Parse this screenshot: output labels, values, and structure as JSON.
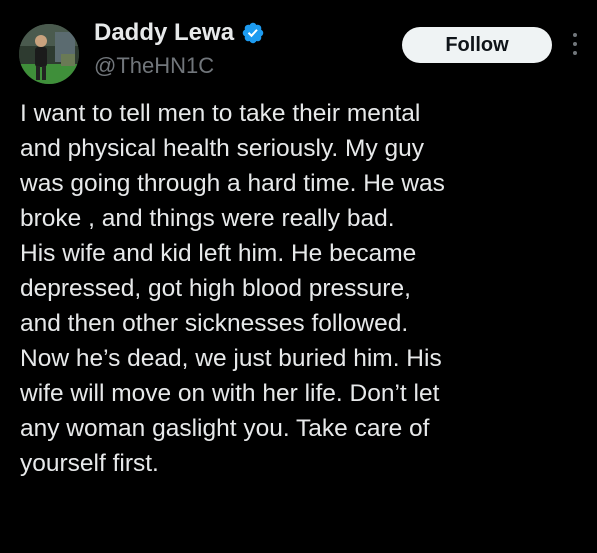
{
  "author": {
    "display_name": "Daddy Lewa",
    "handle": "@TheHN1C",
    "verified": true
  },
  "actions": {
    "follow_label": "Follow"
  },
  "tweet": {
    "lines": [
      "I want to tell men to take their mental",
      "and physical health seriously.  My guy",
      "was going through a hard time. He was",
      "broke , and things were really bad.",
      "His wife and kid left him. He became",
      "depressed, got high blood pressure,",
      "and then other sicknesses followed.",
      "Now he’s dead, we just buried him. His",
      "wife will move on with her life. Don’t let",
      "any woman gaslight you. Take care of",
      "yourself first."
    ]
  },
  "colors": {
    "background": "#000000",
    "text_primary": "#e7e9ea",
    "text_secondary": "#71767b",
    "verified_badge": "#1d9bf0",
    "follow_bg": "#eff3f4",
    "follow_text": "#0f1419"
  },
  "icons": {
    "verified": "verified-badge-icon",
    "more": "more-options-icon"
  }
}
